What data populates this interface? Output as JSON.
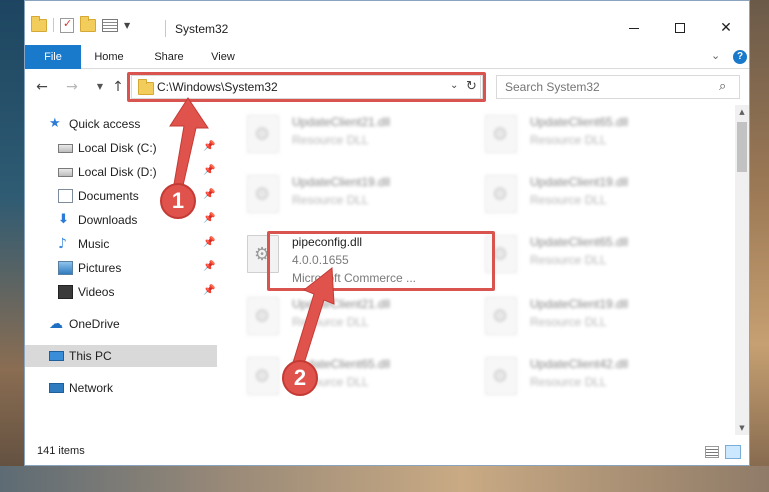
{
  "window": {
    "title": "System32",
    "controls": {
      "minimize": "minimize",
      "maximize": "maximize",
      "close": "✕"
    }
  },
  "ribbon": {
    "tabs": [
      "File",
      "Home",
      "Share",
      "View"
    ],
    "help": "?"
  },
  "address_bar": {
    "path": "C:\\Windows\\System32",
    "refresh": "↻"
  },
  "search": {
    "placeholder": "Search System32"
  },
  "nav_pane": {
    "items": [
      {
        "label": "Quick access",
        "icon": "star-icon"
      },
      {
        "label": "Local Disk (C:)",
        "icon": "drive-icon",
        "pinned": true
      },
      {
        "label": "Local Disk (D:)",
        "icon": "drive-icon",
        "pinned": true
      },
      {
        "label": "Documents",
        "icon": "documents-icon",
        "pinned": true
      },
      {
        "label": "Downloads",
        "icon": "download-icon",
        "pinned": true
      },
      {
        "label": "Music",
        "icon": "music-icon",
        "pinned": true
      },
      {
        "label": "Pictures",
        "icon": "pictures-icon",
        "pinned": true
      },
      {
        "label": "Videos",
        "icon": "videos-icon",
        "pinned": true
      },
      {
        "label": "OneDrive",
        "icon": "onedrive-icon"
      },
      {
        "label": "This PC",
        "icon": "computer-icon",
        "selected": true
      },
      {
        "label": "Network",
        "icon": "network-icon"
      }
    ]
  },
  "files": [
    {
      "name": "UpdateClient21.dll",
      "desc": "Resource DLL"
    },
    {
      "name": "UpdateClient65.dll",
      "desc": "Resource DLL"
    },
    {
      "name": "UpdateClient19.dll",
      "desc": "Resource DLL"
    },
    {
      "name": "UpdateClient19.dll",
      "desc": "Resource DLL"
    },
    {
      "name": "pipeconfig.dll",
      "desc": "4.0.0.1655",
      "sub": "Microsoft Commerce ..."
    },
    {
      "name": "UpdateClient65.dll",
      "desc": "Resource DLL"
    },
    {
      "name": "UpdateClient21.dll",
      "desc": "Resource DLL"
    },
    {
      "name": "UpdateClient19.dll",
      "desc": "Resource DLL"
    },
    {
      "name": "UpdateClient65.dll",
      "desc": "Resource DLL"
    },
    {
      "name": "UpdateClient42.dll",
      "desc": "Resource DLL"
    }
  ],
  "status": {
    "item_count": "141 items"
  },
  "annotations": {
    "step_1": "1",
    "step_2": "2",
    "color": "#e0524c"
  },
  "colors": {
    "accent": "#1979ca",
    "highlight": "#d9534f",
    "selected_bg": "#d9d9d9"
  }
}
